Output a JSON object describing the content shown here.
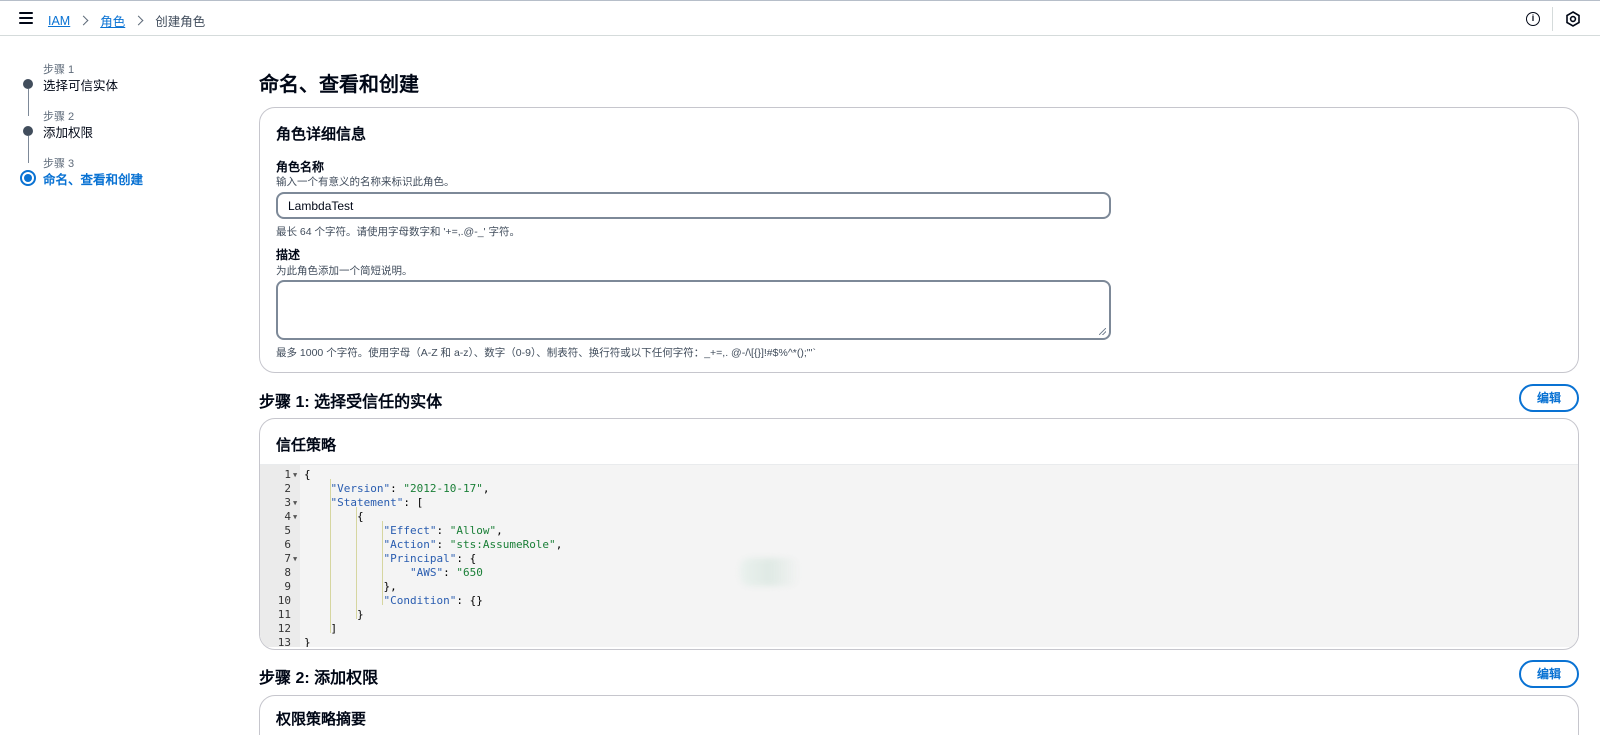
{
  "nav": {
    "breadcrumbs": [
      "IAM",
      "角色"
    ],
    "current": "创建角色"
  },
  "steps": [
    {
      "kicker": "步骤 1",
      "label": "选择可信实体"
    },
    {
      "kicker": "步骤 2",
      "label": "添加权限"
    },
    {
      "kicker": "步骤 3",
      "label": "命名、查看和创建"
    }
  ],
  "page_title": "命名、查看和创建",
  "role_details": {
    "title": "角色详细信息",
    "name_label": "角色名称",
    "name_desc": "输入一个有意义的名称来标识此角色。",
    "name_value": "LambdaTest",
    "name_hint": "最长 64 个字符。请使用字母数字和 '+=,.@-_' 字符。",
    "desc_label": "描述",
    "desc_desc": "为此角色添加一个简短说明。",
    "desc_value": "",
    "desc_hint": "最多 1000 个字符。使用字母（A-Z 和 a-z）、数字（0-9）、制表符、换行符或以下任何字符：_+=,. @-/\\[{}]!#$%^*();\"'`"
  },
  "step1": {
    "title": "步骤 1: 选择受信任的实体",
    "edit_label": "编辑",
    "card_title": "信任策略"
  },
  "code_lines": [
    {
      "n": "1",
      "fold": true,
      "text": "{"
    },
    {
      "n": "2",
      "fold": false,
      "text": "    \"Version\": \"2012-10-17\","
    },
    {
      "n": "3",
      "fold": true,
      "text": "    \"Statement\": ["
    },
    {
      "n": "4",
      "fold": true,
      "text": "        {"
    },
    {
      "n": "5",
      "fold": false,
      "text": "            \"Effect\": \"Allow\","
    },
    {
      "n": "6",
      "fold": false,
      "text": "            \"Action\": \"sts:AssumeRole\","
    },
    {
      "n": "7",
      "fold": true,
      "text": "            \"Principal\": {"
    },
    {
      "n": "8",
      "fold": false,
      "text": "                \"AWS\": \"650"
    },
    {
      "n": "9",
      "fold": false,
      "text": "            },"
    },
    {
      "n": "10",
      "fold": false,
      "text": "            \"Condition\": {}"
    },
    {
      "n": "11",
      "fold": false,
      "text": "        }"
    },
    {
      "n": "12",
      "fold": false,
      "text": "    ]"
    },
    {
      "n": "13",
      "fold": false,
      "text": "}"
    }
  ],
  "step2": {
    "title": "步骤 2: 添加权限",
    "edit_label": "编辑",
    "card_title": "权限策略摘要"
  },
  "icons": {
    "menu": "hamburger-icon",
    "info": "info-icon",
    "settings": "settings-icon"
  },
  "colors": {
    "link": "#0972d3",
    "text": "#000716",
    "border": "#c6c6cd"
  }
}
